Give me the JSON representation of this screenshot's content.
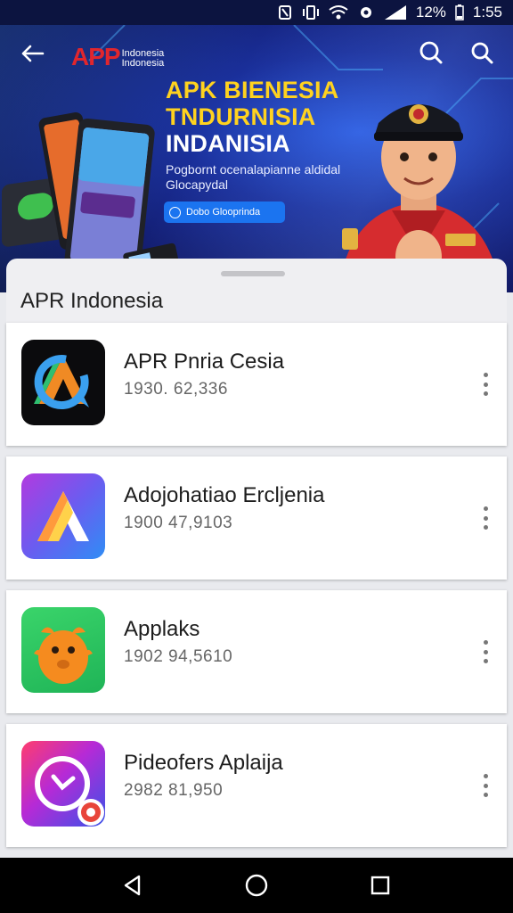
{
  "status_bar": {
    "battery": "12%",
    "time": "1:55",
    "icons": [
      "nfc-icon",
      "vibrate-icon",
      "wifi-icon",
      "signal-icon",
      "battery-icon"
    ]
  },
  "banner": {
    "logo_main": "APP",
    "logo_sub": "Indonesia Indonesia",
    "headline": [
      "APK BIENESIA",
      "TNDURNISIA",
      "INDANISIA"
    ],
    "subtitle": "Pogbornt ocenalapianne aldidal Glocapydal",
    "cta_label": "Dobo Glooprinda",
    "colors": {
      "accent": "#ffd21f",
      "brand": "#e1262d",
      "cta": "#1b74f0"
    }
  },
  "sheet": {
    "title": "APR Indonesia"
  },
  "apps": [
    {
      "name": "APR Pnria Cesia",
      "meta": "1930. 62,336",
      "icon": "app-icon-a-refresh"
    },
    {
      "name": "Adojohatiao Ercljenia",
      "meta": "1900  47,9103",
      "icon": "app-icon-a-gradient"
    },
    {
      "name": "Applaks",
      "meta": "1902  94,5610",
      "icon": "app-icon-mascot"
    },
    {
      "name": "Pideofers Aplaija",
      "meta": "2982  81,950",
      "icon": "app-icon-clock"
    }
  ],
  "navbar": {
    "icons": [
      "back-triangle-icon",
      "home-circle-icon",
      "recents-square-icon"
    ]
  }
}
